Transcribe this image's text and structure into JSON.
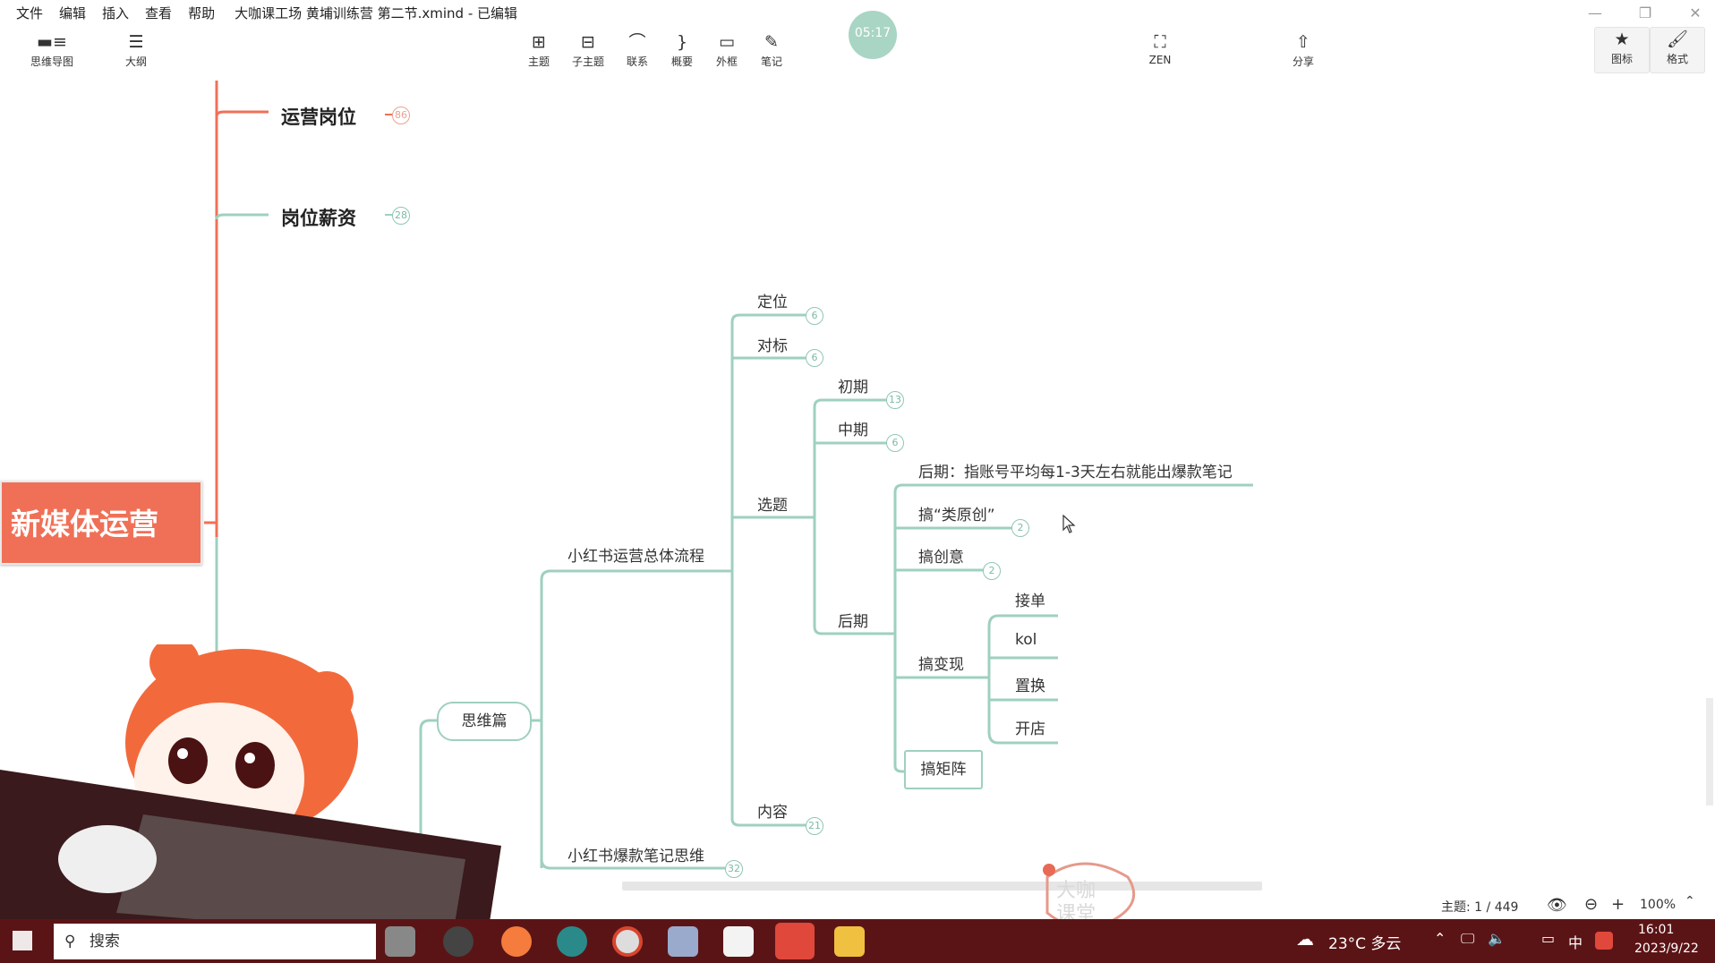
{
  "menu": {
    "items": [
      "文件",
      "编辑",
      "插入",
      "查看",
      "帮助"
    ],
    "doc_title": "大咖课工场 黄埔训练营 第二节.xmind - 已编辑"
  },
  "toolbar": {
    "left": [
      {
        "label": "思维导图",
        "icon": "mindmap-icon"
      },
      {
        "label": "大纲",
        "icon": "outline-icon"
      }
    ],
    "center": [
      {
        "label": "主题",
        "icon": "topic-icon"
      },
      {
        "label": "子主题",
        "icon": "subtopic-icon"
      },
      {
        "label": "联系",
        "icon": "relationship-icon"
      },
      {
        "label": "概要",
        "icon": "summary-icon"
      },
      {
        "label": "外框",
        "icon": "boundary-icon"
      },
      {
        "label": "笔记",
        "icon": "note-icon"
      }
    ],
    "zen": "ZEN",
    "share": "分享",
    "right": [
      {
        "label": "图标",
        "icon": "star-icon"
      },
      {
        "label": "格式",
        "icon": "brush-icon"
      }
    ],
    "timer": "05:17"
  },
  "mindmap": {
    "central": "新媒体运营",
    "top_branches": [
      {
        "label": "运营岗位",
        "count": "86"
      },
      {
        "label": "岗位薪资",
        "count": "28"
      }
    ],
    "thinking": "思维篇",
    "process": "小红书运营总体流程",
    "positioning": {
      "label": "定位",
      "count": "6"
    },
    "benchmark": {
      "label": "对标",
      "count": "6"
    },
    "topic_selection": "选题",
    "early": {
      "label": "初期",
      "count": "13"
    },
    "middle": {
      "label": "中期",
      "count": "6"
    },
    "late": "后期",
    "late_note": "后期：指账号平均每1-3天左右就能出爆款笔记",
    "quasi_original": {
      "label": "搞“类原创”",
      "count": "2"
    },
    "creativity": {
      "label": "搞创意",
      "count": "2"
    },
    "monetize": "搞变现",
    "monetize_items": [
      "接单",
      "kol",
      "置换",
      "开店"
    ],
    "matrix": "搞矩阵",
    "content": {
      "label": "内容",
      "count": "21"
    },
    "viral": {
      "label": "小红书爆款笔记思维",
      "count": "32"
    }
  },
  "statusbar": {
    "topics_label": "主题: 1 / 449",
    "zoom": "100%"
  },
  "taskbar": {
    "search": "搜索",
    "weather": "23°C 多云",
    "ime": "中",
    "time": "16:01",
    "date": "2023/9/22"
  },
  "watermark": "大咖课堂",
  "colors": {
    "central": "#f07057",
    "branch_line_red": "#f07057",
    "branch_line_green": "#9fd0bf",
    "taskbar": "#5b1416",
    "timer": "#a8d5c4"
  }
}
